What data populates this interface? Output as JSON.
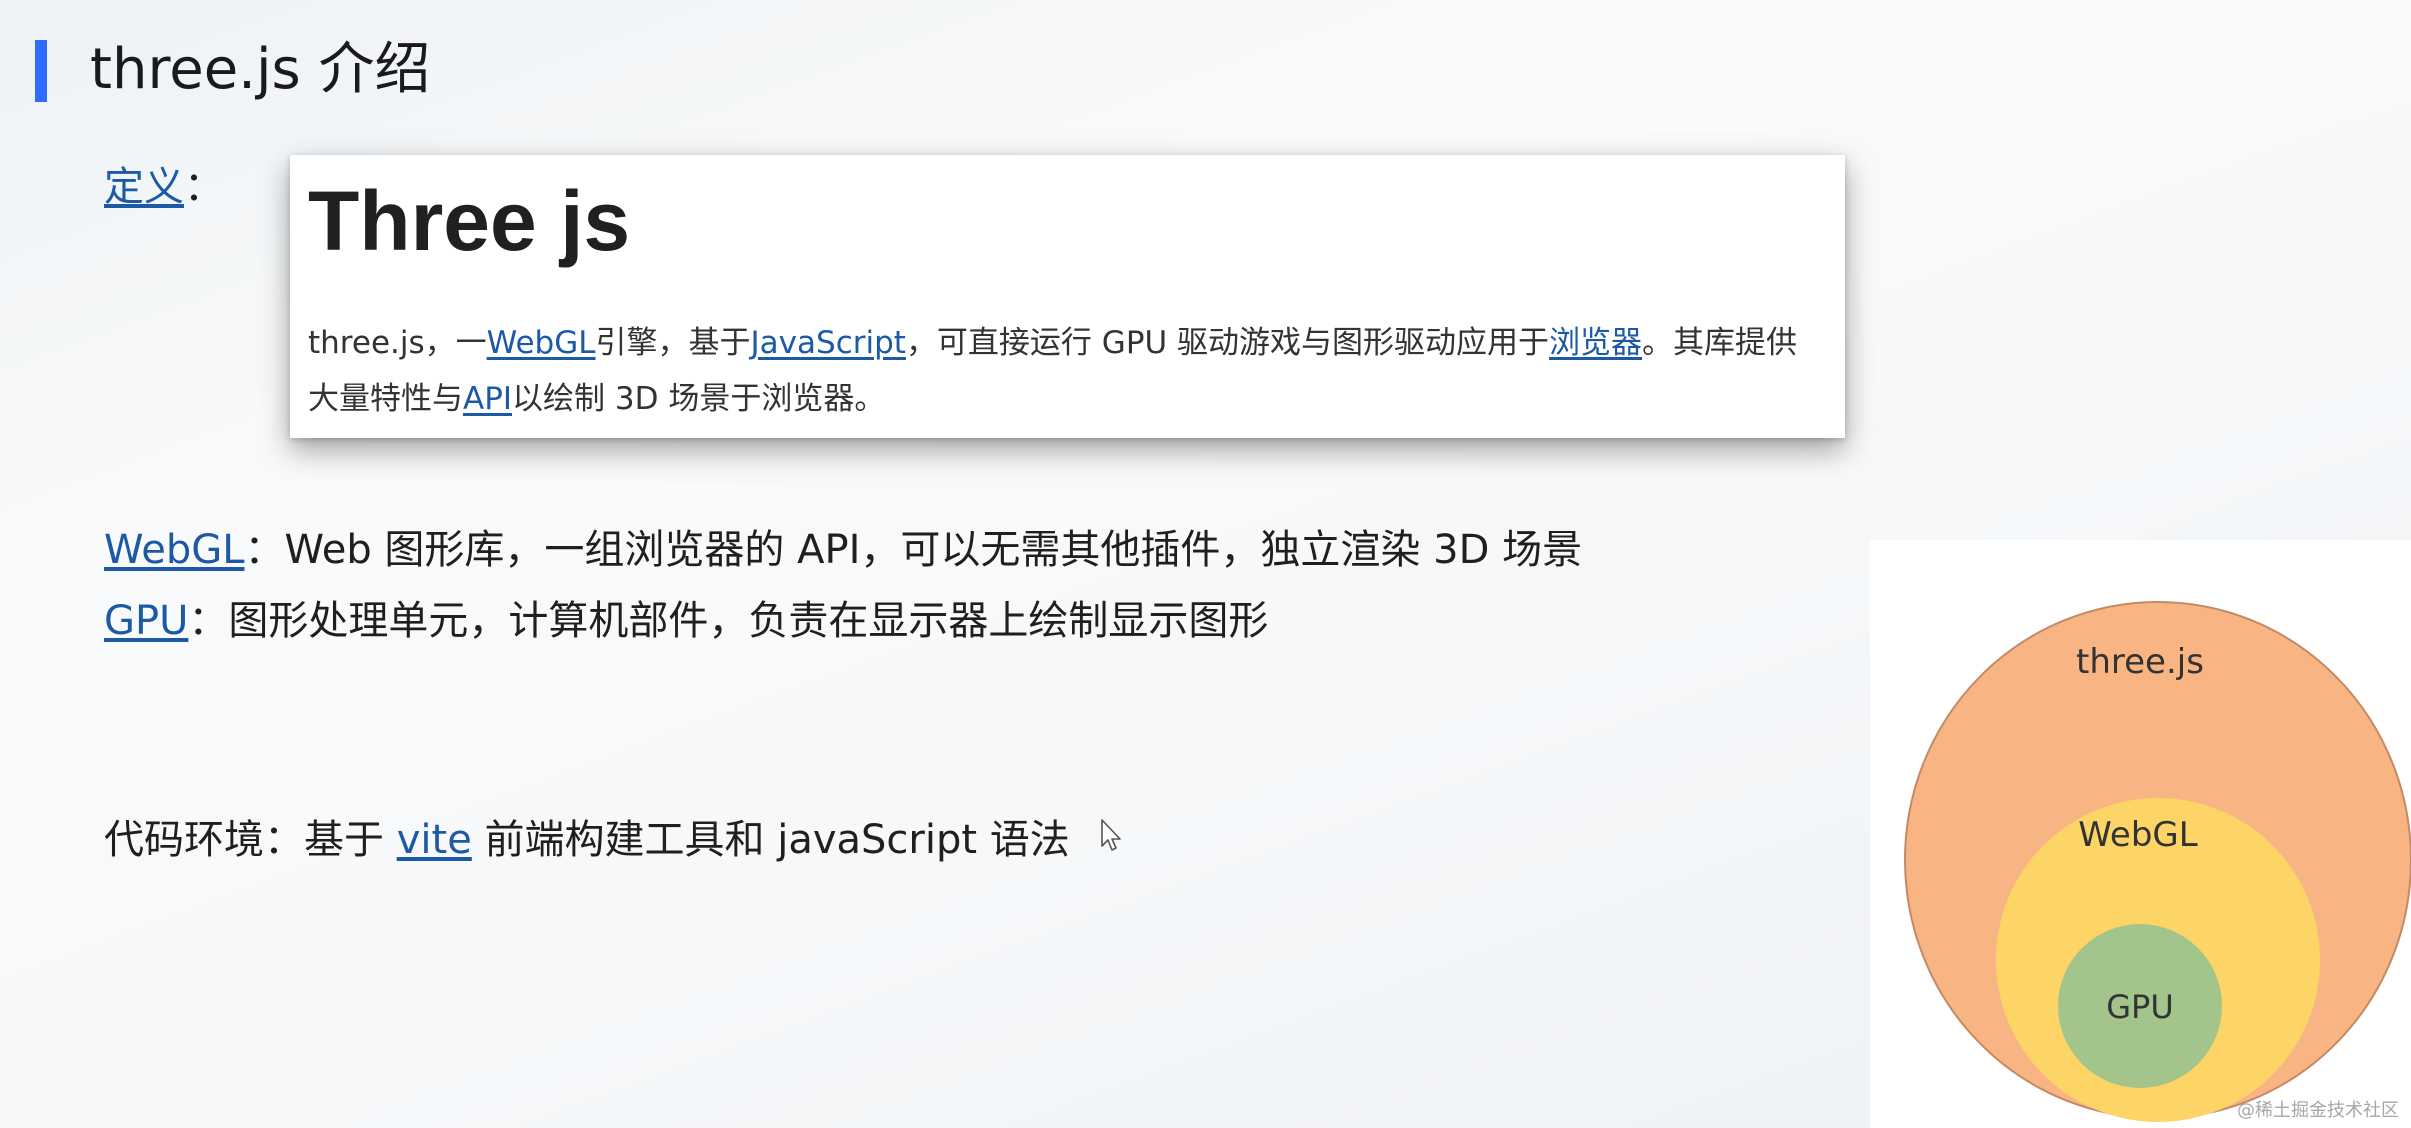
{
  "header": {
    "title": "three.js 介绍"
  },
  "definition": {
    "label_link": "定义",
    "label_suffix": "：",
    "card": {
      "heading": "Three js",
      "text_parts": [
        {
          "text": "three.js，一",
          "link": false
        },
        {
          "text": "WebGL",
          "link": true
        },
        {
          "text": "引擎，基于",
          "link": false
        },
        {
          "text": "JavaScript",
          "link": true
        },
        {
          "text": "，可直接运行 GPU 驱动游戏与图形驱动应用于",
          "link": false
        },
        {
          "text": "浏览器",
          "link": true
        },
        {
          "text": "。其库提供大量特性与",
          "link": false
        },
        {
          "text": "API",
          "link": true
        },
        {
          "text": "以绘制 3D 场景于浏览器。",
          "link": false
        }
      ]
    }
  },
  "terms": {
    "webgl_link": "WebGL",
    "webgl_desc": "：Web 图形库，一组浏览器的 API，可以无需其他插件，独立渲染 3D 场景",
    "gpu_link": "GPU",
    "gpu_desc": "：图形处理单元，计算机部件，负责在显示器上绘制显示图形"
  },
  "environment": {
    "prefix": "代码环境：基于 ",
    "vite_link": "vite",
    "suffix": " 前端构建工具和  javaScript 语法"
  },
  "diagram": {
    "outer_label": "three.js",
    "middle_label": "WebGL",
    "inner_label": "GPU",
    "colors": {
      "outer": "#f8b583",
      "middle": "#fdd566",
      "inner": "#a3c58b",
      "outer_stroke": "#c48a65"
    }
  },
  "watermark": "@稀土掘金技术社区",
  "colors": {
    "accent": "#2f6bff",
    "link": "#1c5aa6"
  }
}
